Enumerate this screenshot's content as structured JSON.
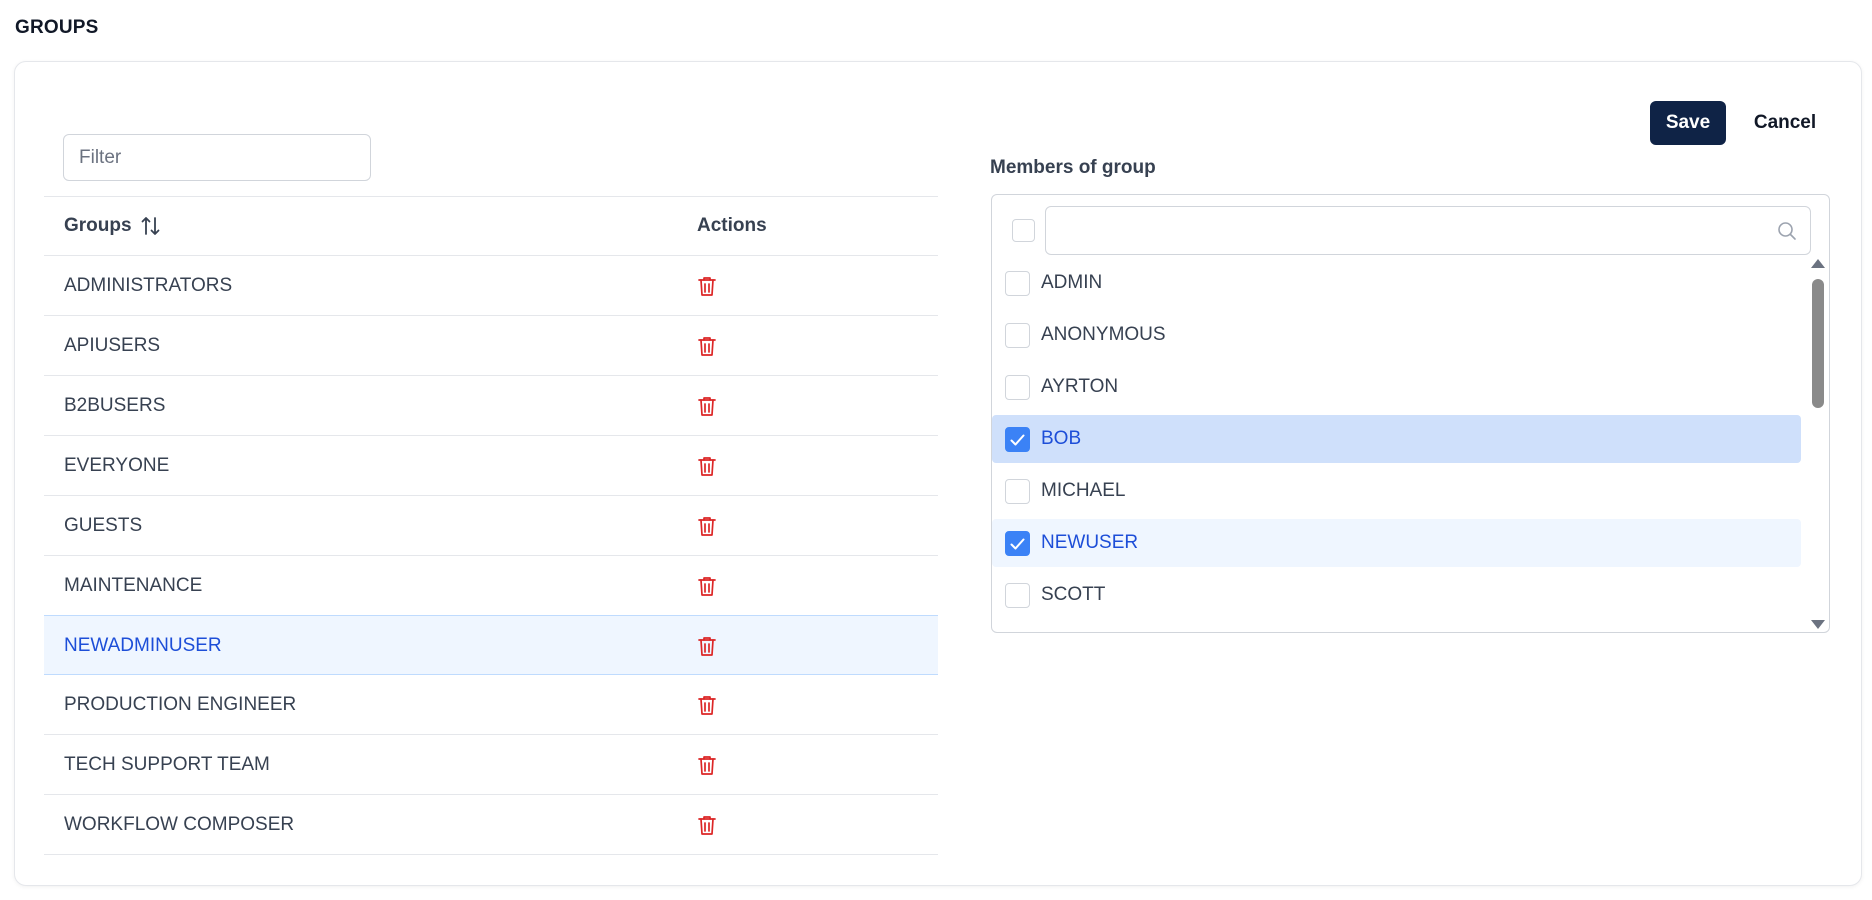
{
  "page": {
    "title": "GROUPS"
  },
  "filter": {
    "placeholder": "Filter",
    "value": ""
  },
  "table": {
    "col_groups": "Groups",
    "col_actions": "Actions",
    "rows": [
      {
        "name": "ADMINISTRATORS",
        "selected": false
      },
      {
        "name": "APIUSERS",
        "selected": false
      },
      {
        "name": "B2BUSERS",
        "selected": false
      },
      {
        "name": "EVERYONE",
        "selected": false
      },
      {
        "name": "GUESTS",
        "selected": false
      },
      {
        "name": "MAINTENANCE",
        "selected": false
      },
      {
        "name": "NEWADMINUSER",
        "selected": true
      },
      {
        "name": "PRODUCTION ENGINEER",
        "selected": false
      },
      {
        "name": "TECH SUPPORT TEAM",
        "selected": false
      },
      {
        "name": "WORKFLOW COMPOSER",
        "selected": false
      }
    ]
  },
  "actions": {
    "save_label": "Save",
    "cancel_label": "Cancel"
  },
  "members": {
    "label": "Members of group",
    "search_value": "",
    "items": [
      {
        "name": "ADMIN",
        "checked": false
      },
      {
        "name": "ANONYMOUS",
        "checked": false
      },
      {
        "name": "AYRTON",
        "checked": false
      },
      {
        "name": "BOB",
        "checked": true
      },
      {
        "name": "MICHAEL",
        "checked": false
      },
      {
        "name": "NEWUSER",
        "checked": true
      },
      {
        "name": "SCOTT",
        "checked": false
      }
    ]
  },
  "icons": {
    "sort": "sort-icon",
    "delete": "trash-icon",
    "search": "search-icon",
    "check": "check-icon"
  },
  "colors": {
    "primary": "#0f2346",
    "danger": "#dc2626",
    "checkbox": "#3b82f6",
    "selected_text": "#1d4ed8",
    "selected_row": "#eff6ff",
    "highlight_row": "#cfe0fb"
  }
}
